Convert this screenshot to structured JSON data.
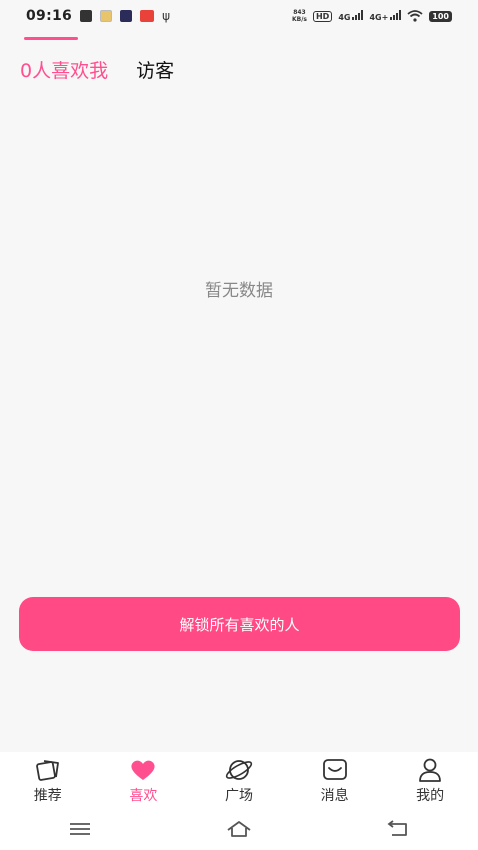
{
  "status_bar": {
    "time": "09:16",
    "net_speed_value": "843",
    "net_speed_unit": "KB/s",
    "hd_label": "HD",
    "sig1_label": "4G",
    "sig2_label": "4G+",
    "battery": "100"
  },
  "tabs": [
    {
      "label": "0人喜欢我",
      "active": true
    },
    {
      "label": "访客",
      "active": false
    }
  ],
  "empty_state": "暂无数据",
  "unlock_button": "解锁所有喜欢的人",
  "bottom_nav": [
    {
      "label": "推荐",
      "icon": "cards-icon",
      "active": false
    },
    {
      "label": "喜欢",
      "icon": "heart-icon",
      "active": true
    },
    {
      "label": "广场",
      "icon": "planet-icon",
      "active": false
    },
    {
      "label": "消息",
      "icon": "message-icon",
      "active": false
    },
    {
      "label": "我的",
      "icon": "profile-icon",
      "active": false
    }
  ],
  "colors": {
    "accent": "#ff4f8f",
    "button": "#ff4a86",
    "background": "#f7f7f7"
  }
}
